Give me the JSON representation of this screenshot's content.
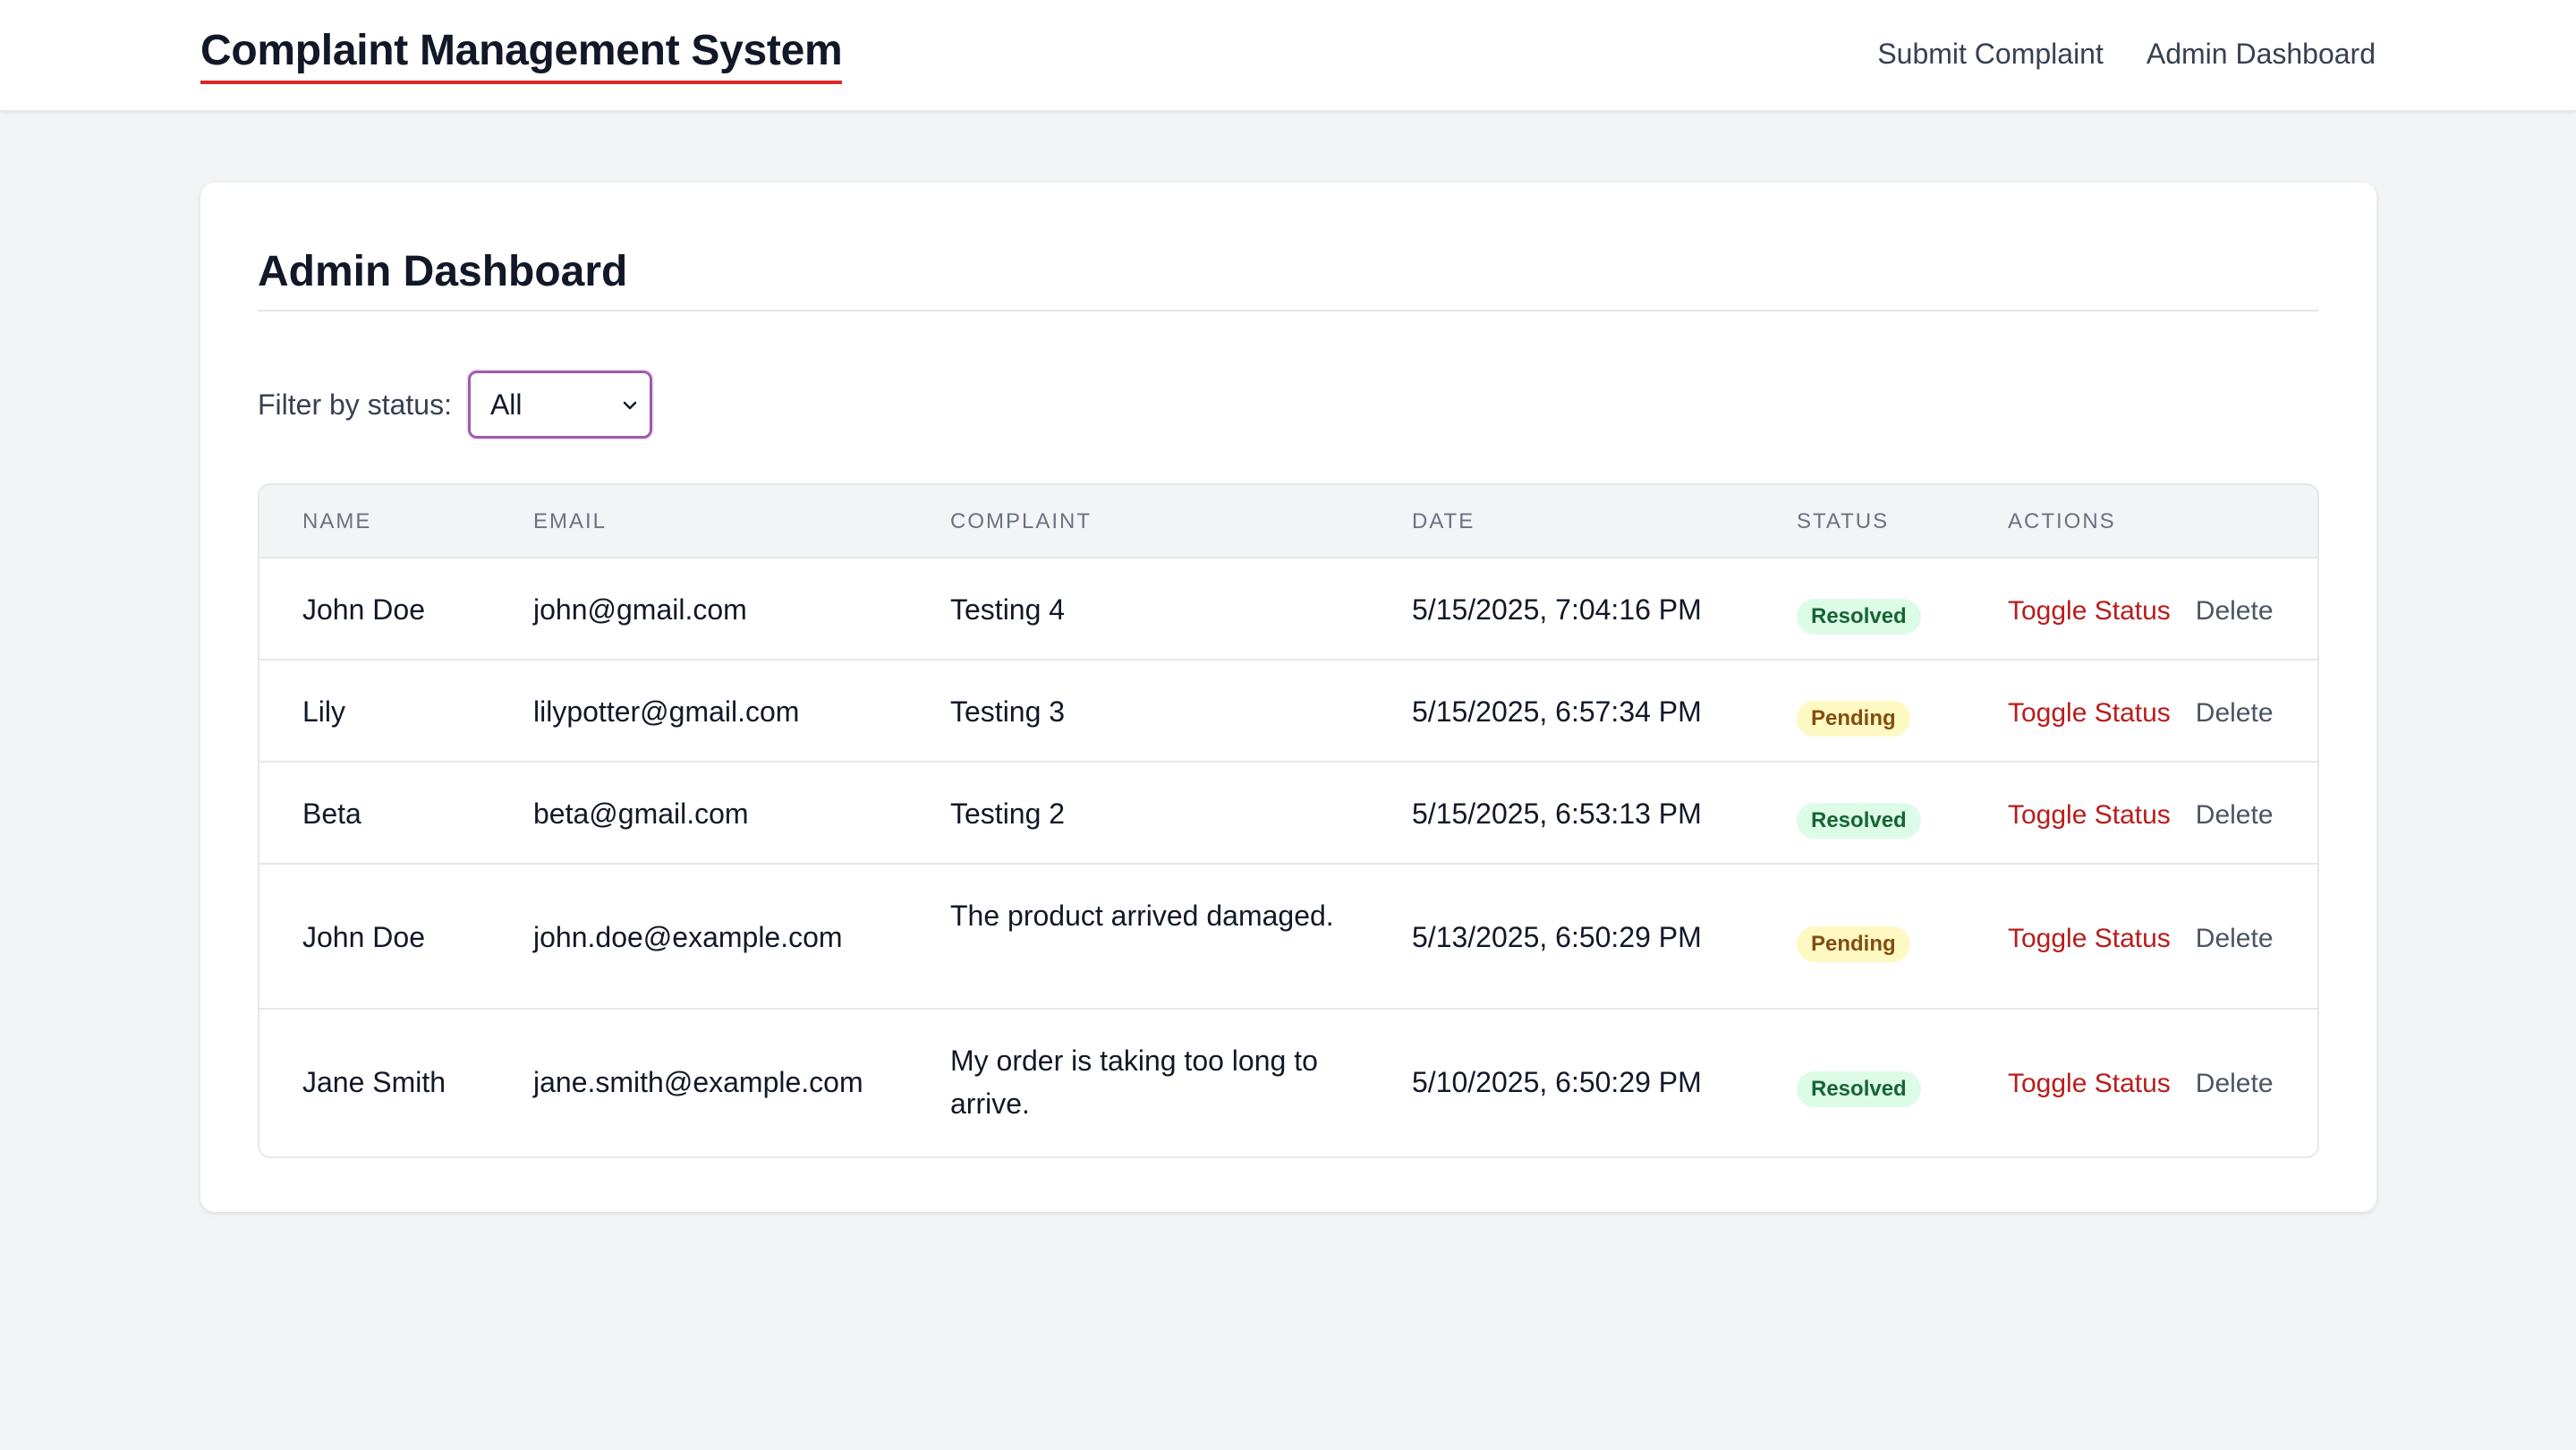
{
  "nav": {
    "brand": "Complaint Management System",
    "links": [
      "Submit Complaint",
      "Admin Dashboard"
    ]
  },
  "dashboard": {
    "title": "Admin Dashboard",
    "filter_label": "Filter by status:",
    "filter_value": "All"
  },
  "table": {
    "headers": [
      "NAME",
      "EMAIL",
      "COMPLAINT",
      "DATE",
      "STATUS",
      "ACTIONS"
    ],
    "rows": [
      {
        "name": "John Doe",
        "email": "john@gmail.com",
        "complaint": "Testing 4",
        "date": "5/15/2025, 7:04:16 PM",
        "status": "Resolved",
        "toggle": "Toggle Status",
        "delete": "Delete"
      },
      {
        "name": "Lily",
        "email": "lilypotter@gmail.com",
        "complaint": "Testing 3",
        "date": "5/15/2025, 6:57:34 PM",
        "status": "Pending",
        "toggle": "Toggle Status",
        "delete": "Delete"
      },
      {
        "name": "Beta",
        "email": "beta@gmail.com",
        "complaint": "Testing 2",
        "date": "5/15/2025, 6:53:13 PM",
        "status": "Resolved",
        "toggle": "Toggle Status",
        "delete": "Delete"
      },
      {
        "name": "John Doe",
        "email": "john.doe@example.com",
        "complaint": "The product arrived damaged.",
        "date": "5/13/2025, 6:50:29 PM",
        "status": "Pending",
        "toggle": "Toggle Status",
        "delete": "Delete"
      },
      {
        "name": "Jane Smith",
        "email": "jane.smith@example.com",
        "complaint": "My order is taking too long to arrive.",
        "date": "5/10/2025, 6:50:29 PM",
        "status": "Resolved",
        "toggle": "Toggle Status",
        "delete": "Delete"
      }
    ]
  },
  "colors": {
    "accent": "#dc2626",
    "resolved_bg": "#dcfce7",
    "pending_bg": "#fef9c3"
  }
}
